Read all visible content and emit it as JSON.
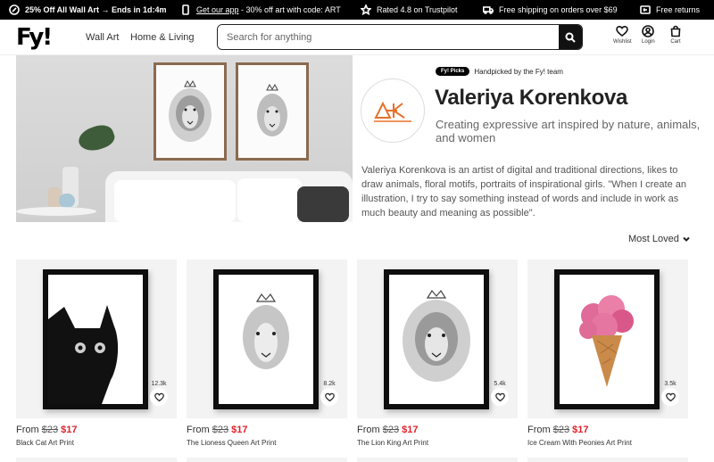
{
  "promo": {
    "sale": "25% Off All Wall Art → Ends in 1d:4m",
    "app_link": "Get our app",
    "app_text": " - 30% off art with code: ART",
    "trustpilot": "Rated 4.8 on Trustpilot",
    "shipping": "Free shipping on orders over $69",
    "returns": "Free returns"
  },
  "header": {
    "logo": "Fy!",
    "nav": [
      "Wall Art",
      "Home & Living"
    ],
    "search_placeholder": "Search for anything",
    "wishlist": "Wishlist",
    "login": "Login",
    "cart": "Cart"
  },
  "artist": {
    "badge": "Fy! Picks",
    "badge_text": "Handpicked by the Fy! team",
    "name": "Valeriya Korenkova",
    "tagline": "Creating expressive art inspired by nature, animals, and women",
    "bio": "Valeriya Korenkova is an artist of digital and traditional directions, likes to draw animals, floral motifs, portraits of inspirational girls. \"When I create an illustration, I try to say something instead of words and include in work as much beauty and meaning as possible\"."
  },
  "sort": {
    "label": "Most Loved"
  },
  "products": [
    {
      "name": "Black Cat Art Print",
      "from": "From ",
      "old_price": "$23",
      "price": "$17",
      "favs": "12.3k",
      "art": "cat"
    },
    {
      "name": "The Lioness Queen Art Print",
      "from": "From ",
      "old_price": "$23",
      "price": "$17",
      "favs": "8.2k",
      "art": "lioness"
    },
    {
      "name": "The Lion King Art Print",
      "from": "From ",
      "old_price": "$23",
      "price": "$17",
      "favs": "5.4k",
      "art": "lion"
    },
    {
      "name": "Ice Cream With Peonies Art Print",
      "from": "From ",
      "old_price": "$23",
      "price": "$17",
      "favs": "3.5k",
      "art": "peonies"
    }
  ],
  "colors": {
    "sale": "#e3202a",
    "promo_bg": "#000000",
    "accent": "#e8702a"
  }
}
